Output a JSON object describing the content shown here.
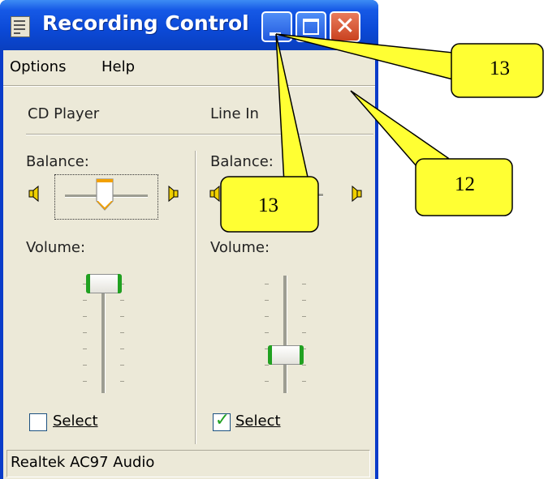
{
  "window": {
    "title": "Recording Control",
    "menu": [
      "Options",
      "Help"
    ],
    "status": "Realtek AC97 Audio"
  },
  "channels": [
    {
      "name": "CD Player",
      "balance_label": "Balance:",
      "volume_label": "Volume:",
      "balance": 0.5,
      "volume": 0.92,
      "select_label": "Select",
      "selected": false
    },
    {
      "name": "Line In",
      "balance_label": "Balance:",
      "volume_label": "Volume:",
      "balance": 0.5,
      "volume": 0.3,
      "select_label": "Select",
      "selected": true
    }
  ],
  "callouts": [
    "13",
    "12",
    "13"
  ],
  "colors": {
    "titlebar": "#0b49d6",
    "client": "#ece9d8",
    "callout_fill": "#ffff33",
    "accent_green": "#21a121",
    "close": "#c94220"
  },
  "icons": [
    "app-icon",
    "minimize-icon",
    "maximize-icon",
    "close-icon",
    "speaker-left-icon",
    "speaker-right-icon",
    "checkmark-icon"
  ]
}
